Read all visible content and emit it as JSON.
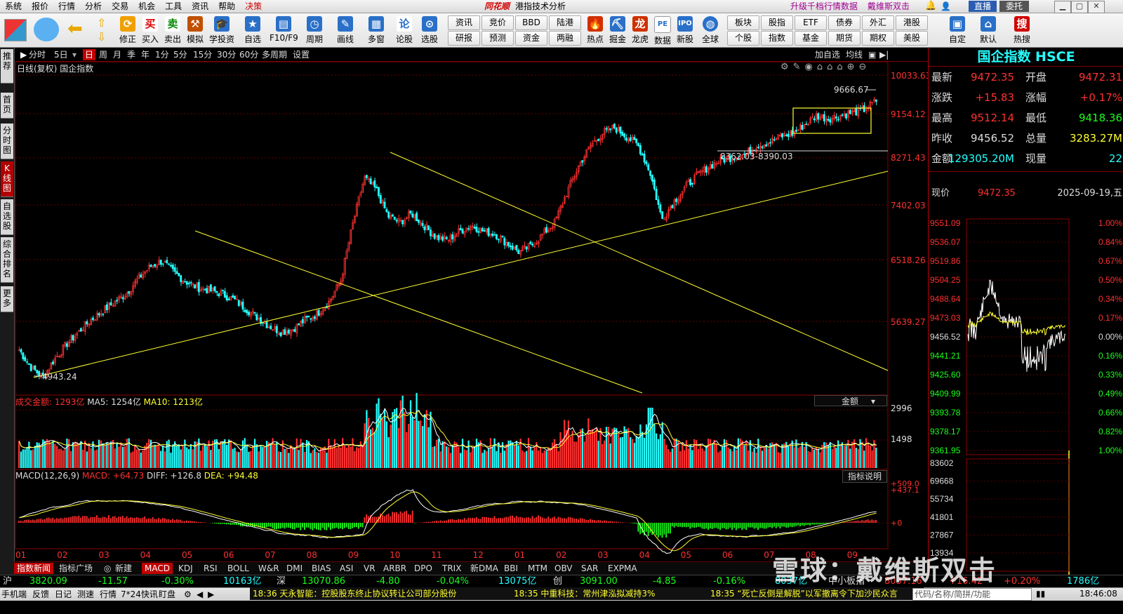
{
  "menubar": {
    "items": [
      "系统",
      "报价",
      "行情",
      "分析",
      "交易",
      "机会",
      "工具",
      "资讯",
      "帮助",
      "决策"
    ],
    "brand": "同花顺",
    "window_title": "港指技术分析",
    "promo_1": "升级千档行情数据",
    "promo_2": "戴维斯双击",
    "live_label": "直播",
    "trust_label": "委托"
  },
  "toolbar": {
    "buttons": [
      "修正",
      "买入",
      "卖出",
      "模拟",
      "学投资",
      "自选",
      "F10/F9",
      "周期",
      "画线",
      "多窗",
      "论股",
      "选股",
      "热点",
      "掘金",
      "龙虎",
      "数据",
      "新股",
      "全球",
      "自定",
      "默认",
      "热搜"
    ],
    "grid": [
      [
        "资讯",
        "竞价",
        "BBD",
        "陆港"
      ],
      [
        "研报",
        "预测",
        "资金",
        "两融"
      ],
      [
        "板块",
        "股指",
        "ETF",
        "债券",
        "外汇",
        "港股"
      ],
      [
        "个股",
        "指数",
        "基金",
        "期货",
        "期权",
        "美股"
      ]
    ]
  },
  "left_tabs": [
    "推荐",
    "首页",
    "分时图",
    "K线图",
    "自选股",
    "综合排名",
    "更多"
  ],
  "period_bar": {
    "items": [
      "分时",
      "5日",
      "日",
      "周",
      "月",
      "季",
      "年",
      "1分",
      "5分",
      "15分",
      "30分",
      "60分",
      "多周期",
      "设置"
    ],
    "active": "日",
    "right_items": [
      "加自选",
      "均线"
    ]
  },
  "kline": {
    "title": "日线(复权)",
    "name": "国企指数",
    "y_ticks": [
      "10033.63",
      "9154.12",
      "8271.43",
      "7402.03",
      "6518.26",
      "5639.27"
    ],
    "high_label": "9666.67",
    "low_label": "4943.24",
    "range_label": "8362.03-8390.03"
  },
  "volume": {
    "label": "成交金额: 1293亿",
    "ma5": "MA5: 1254亿",
    "ma10": "MA10: 1213亿",
    "dropdown": "金额",
    "y_ticks": [
      "2996",
      "1498"
    ]
  },
  "macd": {
    "label": "MACD(12,26,9)",
    "macd": "MACD: +64.73",
    "diff": "DIFF: +126.8",
    "dea": "DEA: +94.48",
    "help": "指标说明",
    "y_ticks": [
      "+509.0",
      "+437.1",
      "+0"
    ]
  },
  "x_axis": [
    "01",
    "02",
    "03",
    "04",
    "05",
    "06",
    "07",
    "08",
    "09",
    "10",
    "11",
    "12",
    "01",
    "02",
    "03",
    "04",
    "05",
    "06",
    "07",
    "08",
    "09"
  ],
  "chart_data": {
    "type": "candlestick",
    "title": "国企指数",
    "ylim": [
      4943.24,
      10033.63
    ],
    "highest": 9666.67,
    "lowest": 4943.24,
    "close_path": [
      5400,
      5100,
      4943,
      5250,
      5500,
      5700,
      5900,
      6050,
      6200,
      6350,
      6600,
      6800,
      6900,
      6700,
      6550,
      6450,
      6400,
      6350,
      6250,
      6100,
      5950,
      5800,
      5700,
      5750,
      5900,
      6000,
      6200,
      6550,
      7500,
      8300,
      8100,
      7650,
      7550,
      7700,
      7500,
      7300,
      7250,
      7400,
      7500,
      7400,
      7350,
      7200,
      7050,
      7150,
      7350,
      7550,
      8050,
      8500,
      8850,
      9050,
      9150,
      9000,
      8850,
      8400,
      7600,
      7900,
      8150,
      8350,
      8500,
      8600,
      8650,
      8700,
      8850,
      8900,
      9000,
      9050,
      9200,
      9350,
      9300,
      9350,
      9400,
      9450,
      9600
    ],
    "volume": {
      "values": [
        1293
      ],
      "ma5": 1254,
      "ma10": 1213,
      "unit": "亿"
    },
    "macd": {
      "macd": 64.73,
      "diff": 126.8,
      "dea": 94.48
    },
    "trendlines": 3
  },
  "quote": {
    "title": "国企指数 HSCE",
    "rows": [
      {
        "k": "最新",
        "v": "9472.35",
        "c": "red",
        "k2": "开盘",
        "v2": "9472.31",
        "c2": "red"
      },
      {
        "k": "涨跌",
        "v": "+15.83",
        "c": "red",
        "k2": "涨幅",
        "v2": "+0.17%",
        "c2": "red"
      },
      {
        "k": "最高",
        "v": "9512.14",
        "c": "red",
        "k2": "最低",
        "v2": "9418.36",
        "c2": "green"
      },
      {
        "k": "昨收",
        "v": "9456.52",
        "c": "white",
        "k2": "总量",
        "v2": "3283.27M",
        "c2": "yellow"
      },
      {
        "k": "金额",
        "v": "129305.20M",
        "c": "cyan",
        "k2": "现量",
        "v2": "22",
        "c2": "cyan"
      }
    ],
    "now_label": "现价",
    "now_value": "9472.35",
    "date": "2025-09-19,五"
  },
  "mini": {
    "prices": [
      "9551.09",
      "9536.07",
      "9519.86",
      "9504.25",
      "9488.64",
      "9473.03",
      "9456.52",
      "9441.21",
      "9425.60",
      "9409.99",
      "9393.78",
      "9378.17",
      "9361.95"
    ],
    "pcts": [
      "1.00%",
      "0.84%",
      "0.67%",
      "0.50%",
      "0.34%",
      "0.17%",
      "0.00%",
      "0.16%",
      "0.33%",
      "0.49%",
      "0.66%",
      "0.82%",
      "1.00%"
    ],
    "vols": [
      "83602",
      "69668",
      "55734",
      "41801",
      "27867",
      "13934"
    ]
  },
  "bottom_tabs": [
    "指数新闻",
    "指标广场",
    "新建",
    "MACD",
    "KDJ",
    "RSI",
    "BOLL",
    "W&R",
    "DMI",
    "BIAS",
    "ASI",
    "VR",
    "ARBR",
    "DPO",
    "TRIX",
    "新DMA",
    "BBI",
    "MTM",
    "OBV",
    "SAR",
    "EXPMA"
  ],
  "ticker": {
    "sh": {
      "name": "沪",
      "price": "3820.09",
      "chg": "-11.57",
      "pct": "-0.30%",
      "amt": "10163亿"
    },
    "sz": {
      "name": "深",
      "price": "13070.86",
      "chg": "-4.80",
      "pct": "-0.04%",
      "amt": "13075亿"
    },
    "cy": {
      "name": "创",
      "price": "3091.00",
      "chg": "-4.85",
      "pct": "-0.16%",
      "amt": "8037亿"
    },
    "mid": {
      "name": "中小板指",
      "price": "8037.16",
      "chg": "+16.42",
      "pct": "+0.20%",
      "amt": "1786亿"
    }
  },
  "statusbar": {
    "items": [
      "手机端",
      "反馈",
      "日记",
      "测速",
      "行情",
      "7*24快讯",
      "盯盘"
    ],
    "news": [
      "18:36 天永智能：控股股东终止协议转让公司部分股份",
      "18:35 中重科技：常州津泓拟减持3%",
      "18:35 “死亡反倒是解脱”以军撤离令下加沙民众言"
    ],
    "search_placeholder": "代码/名称/简拼/功能",
    "clock": "18:46:08"
  },
  "watermark": "雪球：戴维斯双击"
}
